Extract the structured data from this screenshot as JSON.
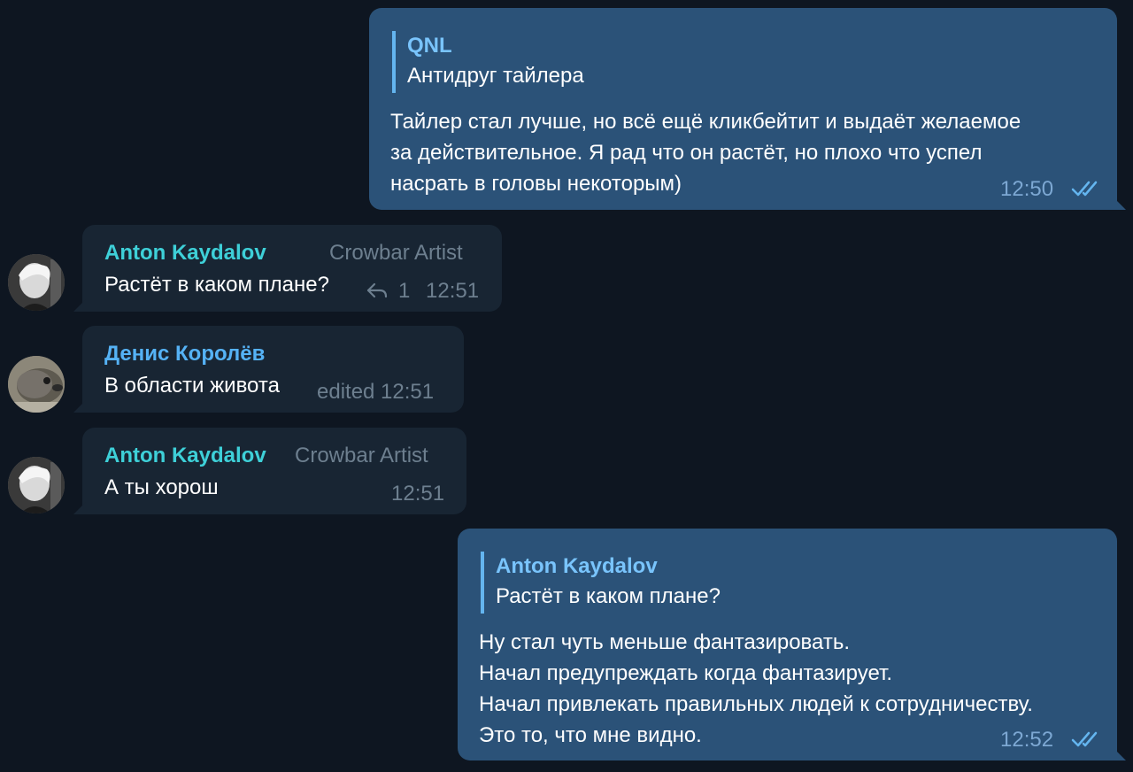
{
  "messages": [
    {
      "reply": {
        "name": "QNL",
        "text": "Антидруг тайлера"
      },
      "lines": [
        "Тайлер стал лучше, но всё ещё кликбейтит и выдаёт желаемое",
        "за действительное. Я рад что он растёт, но плохо что успел",
        "насрать в головы некоторым)"
      ],
      "time": "12:50"
    },
    {
      "sender": "Anton Kaydalov",
      "title": "Crowbar Artist",
      "text": "Растёт в каком плане?",
      "reply_count": "1",
      "time": "12:51"
    },
    {
      "sender": "Денис Королёв",
      "text": "В области живота",
      "time": "edited 12:51"
    },
    {
      "sender": "Anton Kaydalov",
      "title": "Crowbar Artist",
      "text": "А ты хорош",
      "time": "12:51"
    },
    {
      "reply": {
        "name": "Anton Kaydalov",
        "text": "Растёт в каком плане?"
      },
      "lines": [
        "Ну стал чуть меньше фантазировать.",
        "Начал предупреждать когда фантазирует.",
        "Начал привлекать правильных людей к сотрудничеству.",
        "Это то, что мне видно."
      ],
      "time": "12:52"
    }
  ],
  "colors": {
    "background": "#0e1621",
    "outgoing": "#2b5278",
    "incoming": "#182533",
    "name_anton": "#3ed0d8",
    "name_denis": "#55b2f5",
    "reply_accent": "#64b5ef",
    "check_color": "#64b5ef"
  },
  "icons": [
    "double-check-icon",
    "reply-arrow-icon",
    "avatar"
  ]
}
